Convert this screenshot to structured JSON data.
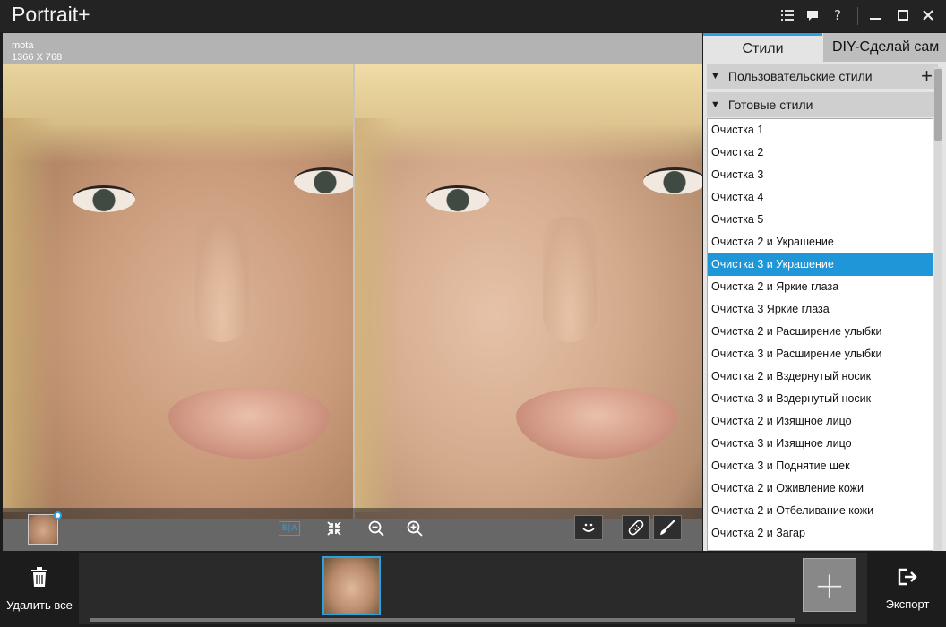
{
  "app": {
    "title": "Portrait+"
  },
  "titlebar": {
    "list_icon": "list-icon",
    "feedback_icon": "speech-bubble-icon",
    "help_label": "?",
    "minimize_icon": "minimize-icon",
    "maximize_icon": "maximize-icon",
    "close_icon": "close-icon"
  },
  "viewer": {
    "image_name": "mota",
    "image_size": "1366 X 768"
  },
  "panel": {
    "tabs": [
      {
        "label": "Стили",
        "active": true
      },
      {
        "label": "DIY-Сделай сам",
        "active": false
      }
    ],
    "custom_styles_label": "Пользовательские стили",
    "ready_styles_label": "Готовые стили",
    "styles": [
      "Очистка 1",
      "Очистка 2",
      "Очистка 3",
      "Очистка 4",
      "Очистка 5",
      "Очистка 2 и Украшение",
      "Очистка 3 и Украшение",
      "Очистка 2 и Яркие глаза",
      "Очистка 3 Яркие глаза",
      "Очистка 2 и Расширение улыбки",
      "Очистка 3 и Расширение улыбки",
      "Очистка 2 и Вздернутый носик",
      "Очистка 3 и Вздернутый носик",
      "Очистка 2 и Изящное лицо",
      "Очистка 3 и Изящное лицо",
      "Очистка 3 и Поднятие щек",
      "Очистка 2 и Оживление кожи",
      "Очистка 2 и Отбеливание кожи",
      "Очистка 2 и Загар"
    ],
    "selected_style": "Очистка 3 и Украшение"
  },
  "bottom": {
    "delete_all_label": "Удалить все",
    "export_label": "Экспорт"
  },
  "colors": {
    "accent": "#1e96d8",
    "background": "#1c1c1c",
    "panel": "#e4e4e4"
  }
}
